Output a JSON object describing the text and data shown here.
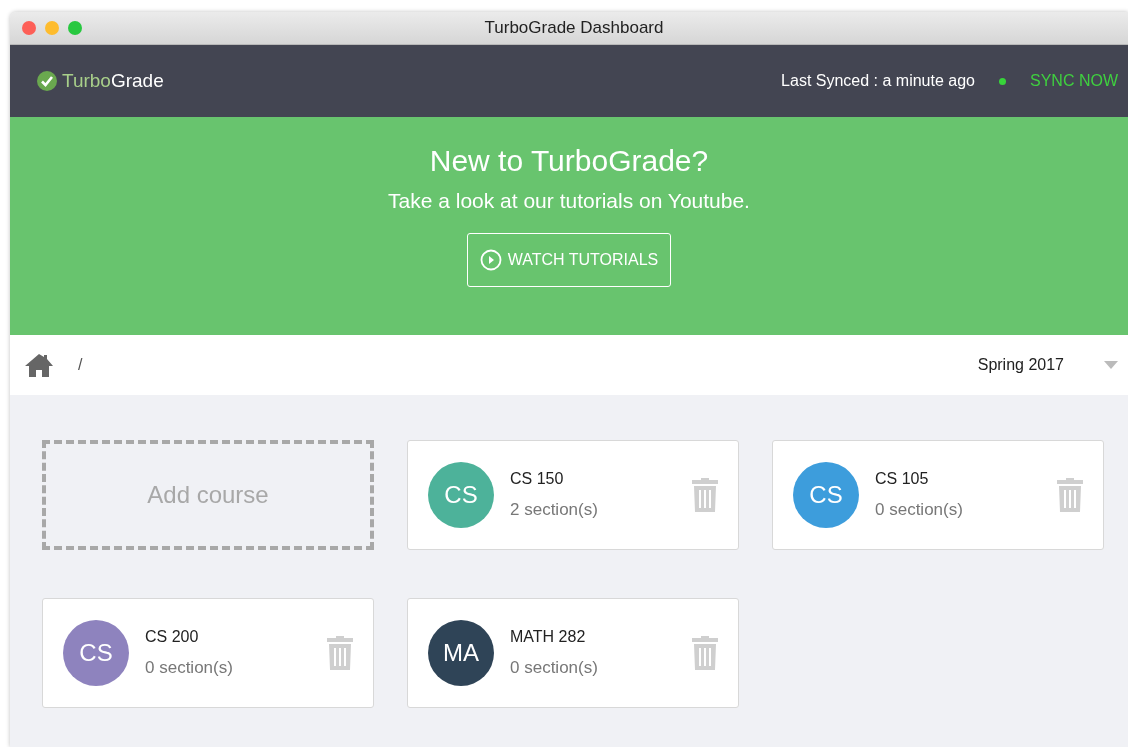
{
  "window": {
    "title": "TurboGrade Dashboard"
  },
  "navbar": {
    "logo": "Turbo**Grade**",
    "sync_status": "Last Synced : a minute ago",
    "sync_button": "SYNC NOW"
  },
  "banner": {
    "heading": "New to TurboGrade?",
    "subtitle": "Take a look at our tutorials on Youtube.",
    "button": "WATCH TUTORIALS"
  },
  "breadcrumb": {
    "separator": "/",
    "term": "Spring 2017"
  },
  "add_course": "Add course",
  "courses": [
    {
      "initials": "CS",
      "name": "CS 150",
      "sections": "2 section(s)",
      "color": "#4db29a"
    },
    {
      "initials": "CS",
      "name": "CS 105",
      "sections": "0 section(s)",
      "color": "#3d9ddc"
    },
    {
      "initials": "CS",
      "name": "CS 200",
      "sections": "0 section(s)",
      "color": "#8e83be"
    },
    {
      "initials": "MA",
      "name": "MATH 282",
      "sections": "0 section(s)",
      "color": "#2f4457"
    }
  ]
}
